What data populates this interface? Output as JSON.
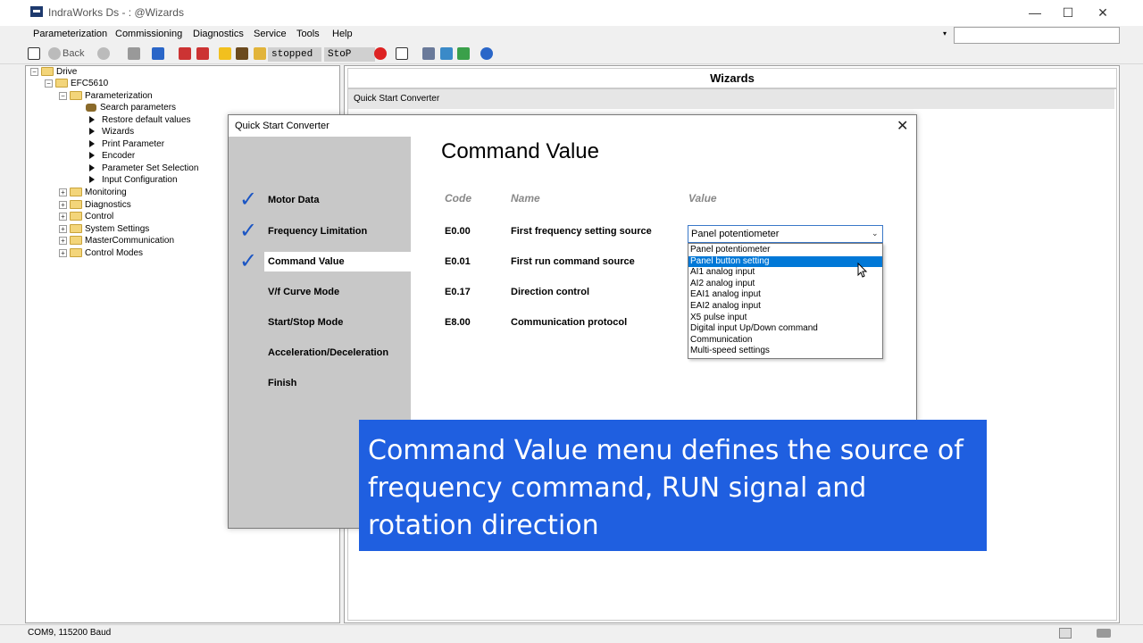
{
  "window": {
    "title": "IndraWorks Ds - : @Wizards",
    "minimize": "—",
    "maximize": "☐",
    "close": "✕"
  },
  "menubar": {
    "items": [
      "Parameterization",
      "Commissioning",
      "Diagnostics",
      "Service",
      "Tools",
      "Help"
    ],
    "dropdown_arrow": "▾"
  },
  "toolbar": {
    "back_label": "Back",
    "status_stopped": "stopped",
    "status_stop_con": "StoP Con"
  },
  "tree": {
    "root": "Drive",
    "device": "EFC5610",
    "parameterization": "Parameterization",
    "param_children": [
      "Search parameters",
      "Restore default values",
      "Wizards",
      "Print Parameter",
      "Encoder",
      "Parameter Set Selection",
      "Input Configuration"
    ],
    "other_nodes": [
      "Monitoring",
      "Diagnostics",
      "Control",
      "System Settings",
      "MasterCommunication",
      "Control Modes"
    ],
    "expand_plus": "+",
    "expand_minus": "−"
  },
  "wizards_panel": {
    "header": "Wizards",
    "row": "Quick Start Converter"
  },
  "dialog": {
    "title": "Quick Start Converter",
    "close": "✕",
    "heading": "Command Value",
    "steps": [
      {
        "label": "Motor Data",
        "done": true
      },
      {
        "label": "Frequency Limitation",
        "done": true
      },
      {
        "label": "Command Value",
        "done": true
      },
      {
        "label": "V/f Curve Mode",
        "done": false
      },
      {
        "label": "Start/Stop Mode",
        "done": false
      },
      {
        "label": "Acceleration/Deceleration",
        "done": false
      },
      {
        "label": "Finish",
        "done": false
      }
    ],
    "check": "✓",
    "columns": {
      "code": "Code",
      "name": "Name",
      "value": "Value"
    },
    "params": [
      {
        "code": "E0.00",
        "name": "First frequency setting source"
      },
      {
        "code": "E0.01",
        "name": "First run command source"
      },
      {
        "code": "E0.17",
        "name": "Direction control"
      },
      {
        "code": "E8.00",
        "name": "Communication protocol"
      }
    ],
    "combo_value": "Panel potentiometer",
    "combo_arrow": "⌄",
    "options": [
      "Panel potentiometer",
      "Panel button setting",
      "AI1 analog input",
      "AI2 analog input",
      "EAI1 analog input",
      "EAI2 analog input",
      "X5 pulse input",
      "Digital input Up/Down command",
      "Communication",
      "Multi-speed settings"
    ],
    "selected_option_index": 1
  },
  "caption": {
    "text": "Command Value menu defines the source of frequency command, RUN signal and rotation direction"
  },
  "statusbar": {
    "text": "COM9, 115200 Baud"
  },
  "colors": {
    "accent": "#0078d7",
    "check": "#1a55c4",
    "caption_bg": "#1f5fe0",
    "step_panel": "#c8c8c8"
  }
}
